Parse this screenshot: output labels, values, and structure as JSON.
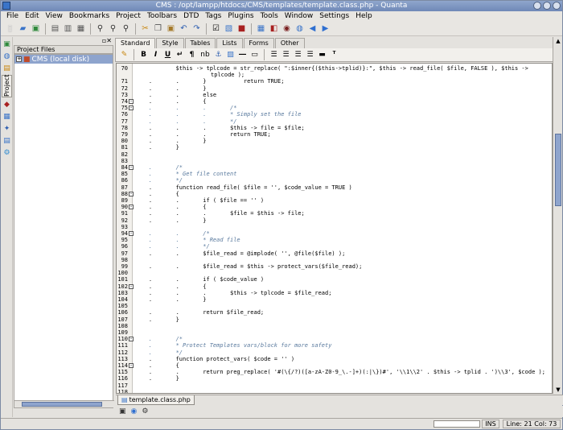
{
  "window": {
    "title": "CMS : /opt/lampp/htdocs/CMS/templates/template.class.php - Quanta"
  },
  "menu": [
    "File",
    "Edit",
    "View",
    "Bookmarks",
    "Project",
    "Toolbars",
    "DTD",
    "Tags",
    "Plugins",
    "Tools",
    "Window",
    "Settings",
    "Help"
  ],
  "toolbar_icons": [
    "new-file-icon",
    "open-file-icon",
    "open-project-icon",
    "save-icon",
    "save-all-icon",
    "print-icon",
    "find-icon",
    "find-next-icon",
    "cut-icon",
    "copy-icon",
    "paste-icon",
    "undo-icon",
    "redo-icon",
    "checkbox-icon",
    "preview-icon",
    "tools-icon",
    "table-icon",
    "image-icon",
    "view-icon",
    "world-icon",
    "back-icon",
    "forward-icon"
  ],
  "dock": {
    "project_tab": "Project"
  },
  "tree": {
    "title": "Project Files",
    "items": [
      {
        "label": "CMS (local disk)"
      }
    ]
  },
  "tabs": [
    "Standard",
    "Style",
    "Tables",
    "Lists",
    "Forms",
    "Other"
  ],
  "tab_tools": [
    "B",
    "I",
    "U",
    "nb"
  ],
  "code": [
    {
      "n": "70",
      "fold": "",
      "text": "            $this -> tplcode = str_replace( \":$inner{($this->tplid)}:\", $this -> read_file( $file, FALSE ), $this ->"
    },
    {
      "n": "71",
      "fold": "",
      "text": "    .       .       }           return TRUE;"
    },
    {
      "n": "72",
      "fold": "",
      "text": "    .       .       }"
    },
    {
      "n": "73",
      "fold": "",
      "text": "    .       .       else"
    },
    {
      "n": "74",
      "fold": "-",
      "text": "    .       .       {"
    },
    {
      "n": "75",
      "fold": "-",
      "text": "    .       .       .       /*"
    },
    {
      "n": "76",
      "fold": "",
      "text": "    .       .       .       * Simply set the file"
    },
    {
      "n": "77",
      "fold": "",
      "text": "    .       .       .       */"
    },
    {
      "n": "78",
      "fold": "",
      "text": "    .       .       .       $this -> file = $file;"
    },
    {
      "n": "79",
      "fold": "",
      "text": "    .       .       .       return TRUE;"
    },
    {
      "n": "80",
      "fold": "",
      "text": "    .       .       }"
    },
    {
      "n": "81",
      "fold": "",
      "text": "    .       }"
    },
    {
      "n": "82",
      "fold": "",
      "text": ""
    },
    {
      "n": "83",
      "fold": "",
      "text": ""
    },
    {
      "n": "84",
      "fold": "-",
      "text": "    .       /*"
    },
    {
      "n": "85",
      "fold": "",
      "text": "    .       * Get file content"
    },
    {
      "n": "86",
      "fold": "",
      "text": "    .       */"
    },
    {
      "n": "87",
      "fold": "",
      "text": "    .       function read_file( $file = '', $code_value = TRUE )"
    },
    {
      "n": "88",
      "fold": "-",
      "text": "    .       {"
    },
    {
      "n": "89",
      "fold": "",
      "text": "    .       .       if ( $file == '' )"
    },
    {
      "n": "90",
      "fold": "-",
      "text": "    .       .       {"
    },
    {
      "n": "91",
      "fold": "",
      "text": "    .       .       .       $file = $this -> file;"
    },
    {
      "n": "92",
      "fold": "",
      "text": "    .       .       }"
    },
    {
      "n": "93",
      "fold": "",
      "text": ""
    },
    {
      "n": "94",
      "fold": "-",
      "text": "    .       .       /*"
    },
    {
      "n": "95",
      "fold": "",
      "text": "    .       .       * Read file"
    },
    {
      "n": "96",
      "fold": "",
      "text": "    .       .       */"
    },
    {
      "n": "97",
      "fold": "",
      "text": "    .       .       $file_read = @implode( '', @file($file) );"
    },
    {
      "n": "98",
      "fold": "",
      "text": ""
    },
    {
      "n": "99",
      "fold": "",
      "text": "    .       .       $file_read = $this -> protect_vars($file_read);"
    },
    {
      "n": "100",
      "fold": "",
      "text": ""
    },
    {
      "n": "101",
      "fold": "",
      "text": "    .       .       if ( $code_value )"
    },
    {
      "n": "102",
      "fold": "-",
      "text": "    .       .       {"
    },
    {
      "n": "103",
      "fold": "",
      "text": "    .       .       .       $this -> tplcode = $file_read;"
    },
    {
      "n": "104",
      "fold": "",
      "text": "    .       .       }"
    },
    {
      "n": "105",
      "fold": "",
      "text": ""
    },
    {
      "n": "106",
      "fold": "",
      "text": "    .       .       return $file_read;"
    },
    {
      "n": "107",
      "fold": "",
      "text": "    .       }"
    },
    {
      "n": "108",
      "fold": "",
      "text": ""
    },
    {
      "n": "109",
      "fold": "",
      "text": ""
    },
    {
      "n": "110",
      "fold": "-",
      "text": "    .       /*"
    },
    {
      "n": "111",
      "fold": "",
      "text": "    .       * Protect Templates vars/block for more safety"
    },
    {
      "n": "112",
      "fold": "",
      "text": "    .       */"
    },
    {
      "n": "113",
      "fold": "",
      "text": "    .       function protect_vars( $code = '' )"
    },
    {
      "n": "114",
      "fold": "-",
      "text": "    .       {"
    },
    {
      "n": "115",
      "fold": "",
      "text": "    .       .       return preg_replace( '#(\\{/?)([a-zA-Z0-9_\\.-]+)(:|\\})#', '\\\\1\\\\2' . $this -> tplid . ')\\\\3', $code );"
    },
    {
      "n": "116",
      "fold": "",
      "text": "    .       }"
    },
    {
      "n": "117",
      "fold": "",
      "text": ""
    },
    {
      "n": "118",
      "fold": "",
      "text": ""
    }
  ],
  "line70_wrap": "tplcode );",
  "file_tab": "template.class.php",
  "status": {
    "mode": "INS",
    "position": "Line: 21 Col: 73"
  }
}
